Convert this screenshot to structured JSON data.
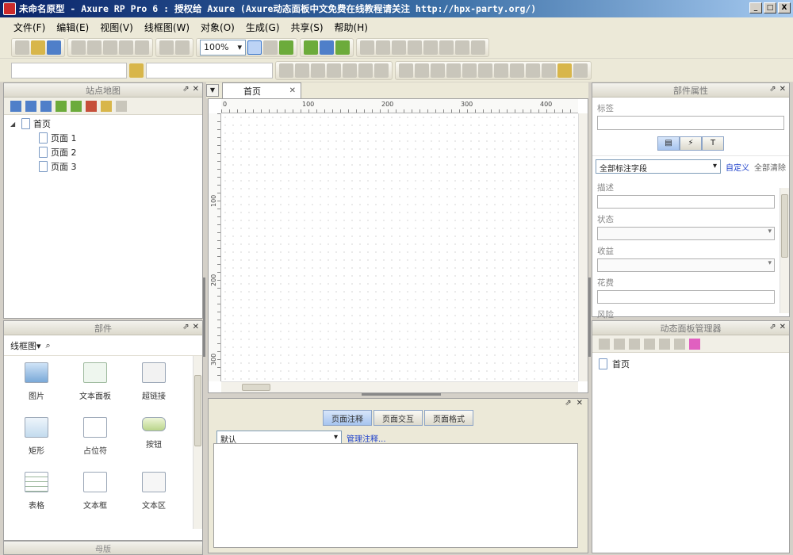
{
  "window": {
    "title": "未命名原型 - Axure RP Pro 6 : 授权给 Axure (Axure动态面板中文免费在线教程请关注 http://hpx-party.org/)",
    "min": "_",
    "max": "□",
    "close": "X"
  },
  "menu": [
    {
      "label": "文件(F)"
    },
    {
      "label": "编辑(E)"
    },
    {
      "label": "视图(V)"
    },
    {
      "label": "线框图(W)"
    },
    {
      "label": "对象(O)"
    },
    {
      "label": "生成(G)"
    },
    {
      "label": "共享(S)"
    },
    {
      "label": "帮助(H)"
    }
  ],
  "toolbar": {
    "zoom": "100%"
  },
  "sitemap": {
    "title": "站点地图",
    "root": "首页",
    "children": [
      "页面 1",
      "页面 2",
      "页面 3"
    ]
  },
  "widgets": {
    "title": "部件",
    "library": "线框图",
    "items": [
      {
        "label": "图片",
        "icon": "image-icon"
      },
      {
        "label": "文本面板",
        "icon": "text-panel-icon"
      },
      {
        "label": "超链接",
        "icon": "hyperlink-icon"
      },
      {
        "label": "矩形",
        "icon": "rectangle-icon"
      },
      {
        "label": "占位符",
        "icon": "placeholder-icon"
      },
      {
        "label": "按钮",
        "icon": "button-icon"
      },
      {
        "label": "表格",
        "icon": "table-icon"
      },
      {
        "label": "文本框",
        "icon": "textbox-icon"
      },
      {
        "label": "文本区",
        "icon": "textarea-icon"
      }
    ],
    "bottom_panel": "母版"
  },
  "document": {
    "tab": "首页",
    "ruler_h": [
      "0",
      "100",
      "200",
      "300",
      "400"
    ],
    "ruler_v": [
      "100",
      "200",
      "300"
    ]
  },
  "notes": {
    "tabs": [
      "页面注释",
      "页面交互",
      "页面格式"
    ],
    "active_tab": 0,
    "select": "默认",
    "manage_link": "管理注释..."
  },
  "properties": {
    "title": "部件属性",
    "label_caption": "标签",
    "ann_select": "全部标注字段",
    "customize": "自定义",
    "clear_all": "全部清除",
    "fields": [
      {
        "label": "描述",
        "type": "text"
      },
      {
        "label": "状态",
        "type": "dropdown"
      },
      {
        "label": "收益",
        "type": "dropdown"
      },
      {
        "label": "花费",
        "type": "text"
      },
      {
        "label": "风险",
        "type": "text"
      }
    ]
  },
  "dynamic_panel": {
    "title": "动态面板管理器",
    "items": [
      "首页"
    ]
  },
  "colors": {
    "title_start": "#0a246a",
    "title_end": "#a6caf0",
    "link": "#2244cc",
    "active_tab": "#a6c4ef"
  }
}
